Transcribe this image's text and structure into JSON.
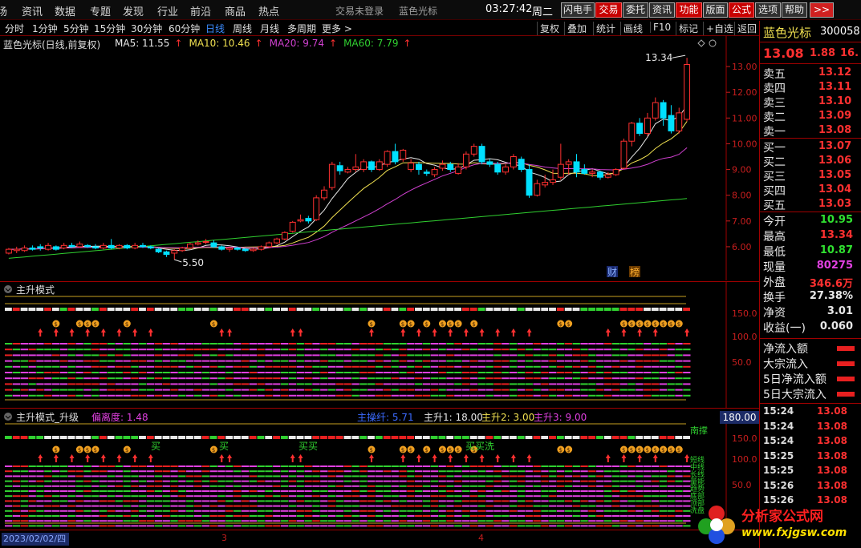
{
  "menu": [
    "场",
    "资讯",
    "数据",
    "专题",
    "发现",
    "行业",
    "前沿",
    "商品",
    "热点"
  ],
  "login_status": "交易未登录",
  "stock_title": "蓝色光标",
  "time": "03:27:42",
  "weekday": "周二",
  "top_buttons": [
    "闪电手",
    "交易",
    "委托",
    "资讯",
    "功能",
    "版面",
    "公式",
    "选项",
    "帮助"
  ],
  "top_button_more": ">>",
  "periods": [
    "分时",
    "1分钟",
    "5分钟",
    "15分钟",
    "30分钟",
    "60分钟",
    "日线",
    "周线",
    "月线",
    "多周期",
    "更多 >"
  ],
  "active_period": "日线",
  "tools": [
    "复权",
    "叠加",
    "统计",
    "画线",
    "F10",
    "标记",
    "+自选",
    "返回"
  ],
  "main_title": "蓝色光标(日线,前复权)",
  "ma": [
    {
      "label": "MA5: 11.55",
      "color": "#e8e8e8"
    },
    {
      "label": "MA10: 10.46",
      "color": "#f0e050"
    },
    {
      "label": "MA20: 9.74",
      "color": "#d040d0"
    },
    {
      "label": "MA60: 7.79",
      "color": "#30d030"
    }
  ],
  "price_axis": [
    "13.00",
    "12.00",
    "11.00",
    "10.00",
    "9.00",
    "8.00",
    "7.00",
    "6.00"
  ],
  "high_annotation": "13.34",
  "low_annotation": "5.50",
  "badges": [
    "财",
    "榜"
  ],
  "pane1": {
    "title": "主升模式",
    "axis": [
      "150.0",
      "100.0",
      "50.0"
    ]
  },
  "pane2": {
    "title": "主升模式_升级",
    "deviation": "偏离度: 1.48",
    "main_text": "主操纤: 5.71",
    "zs1": "主升1: 18.00",
    "zs2": "主升2: 3.00",
    "zs3": "主升3: 9.00",
    "axis": [
      "150.0",
      "100.0",
      "50.0"
    ],
    "axis_highlight": "180.00",
    "buy_labels": [
      "买",
      "买",
      "买买",
      "买买洗"
    ],
    "right_labels": [
      "短线",
      "中线",
      "长线",
      "量能",
      "趋势",
      "底部",
      "顶部",
      "洗盘"
    ],
    "right_top": "南撑"
  },
  "date_axis": {
    "date": "2023/02/02/四",
    "ticks": [
      "3",
      "4"
    ]
  },
  "quote": {
    "name": "蓝色光标",
    "code": "300058",
    "price": "13.08",
    "change": "1.88",
    "pct": "16.",
    "asks": [
      {
        "label": "卖五",
        "price": "13.12"
      },
      {
        "label": "卖四",
        "price": "13.11"
      },
      {
        "label": "卖三",
        "price": "13.10"
      },
      {
        "label": "卖二",
        "price": "13.09"
      },
      {
        "label": "卖一",
        "price": "13.08"
      }
    ],
    "bids": [
      {
        "label": "买一",
        "price": "13.07"
      },
      {
        "label": "买二",
        "price": "13.06"
      },
      {
        "label": "买三",
        "price": "13.05"
      },
      {
        "label": "买四",
        "price": "13.04"
      },
      {
        "label": "买五",
        "price": "13.03"
      }
    ],
    "stats": [
      {
        "label": "今开",
        "value": "10.95",
        "color": "#30e030"
      },
      {
        "label": "最高",
        "value": "13.34",
        "color": "#ff3030"
      },
      {
        "label": "最低",
        "value": "10.87",
        "color": "#30e030"
      },
      {
        "label": "现量",
        "value": "80275",
        "color": "#e040e0"
      },
      {
        "label": "外盘",
        "value": "346.6万",
        "color": "#ff3030"
      },
      {
        "label": "换手",
        "value": "27.38%",
        "color": "#e8e8e8"
      },
      {
        "label": "净资",
        "value": "3.01",
        "color": "#e8e8e8"
      },
      {
        "label": "收益(一)",
        "value": "0.060",
        "color": "#e8e8e8"
      }
    ],
    "flows": [
      "净流入额",
      "大宗流入",
      "5日净流入额",
      "5日大宗流入"
    ],
    "ticks": [
      {
        "time": "15:24",
        "price": "13.08"
      },
      {
        "time": "15:24",
        "price": "13.08"
      },
      {
        "time": "15:24",
        "price": "13.08"
      },
      {
        "time": "15:25",
        "price": "13.08"
      },
      {
        "time": "15:25",
        "price": "13.08"
      },
      {
        "time": "15:26",
        "price": "13.08"
      },
      {
        "time": "15:26",
        "price": "13.08"
      }
    ]
  },
  "watermark": {
    "text": "分析家公式网",
    "url": "www.fxjgsw.com"
  },
  "chart_data": {
    "type": "candlestick",
    "ylim": [
      5.5,
      13.5
    ],
    "candles": [
      [
        5.75,
        5.9,
        5.95,
        5.7
      ],
      [
        5.85,
        5.9,
        6.0,
        5.75
      ],
      [
        5.85,
        5.95,
        6.05,
        5.8
      ],
      [
        5.95,
        5.9,
        6.05,
        5.85
      ],
      [
        6.0,
        5.95,
        6.1,
        5.85
      ],
      [
        5.9,
        6.05,
        6.15,
        5.85
      ],
      [
        6.0,
        5.9,
        6.05,
        5.85
      ],
      [
        5.95,
        6.05,
        6.15,
        5.9
      ],
      [
        6.05,
        6.0,
        6.15,
        5.95
      ],
      [
        6.0,
        6.1,
        6.2,
        5.95
      ],
      [
        6.05,
        6.0,
        6.1,
        5.95
      ],
      [
        6.0,
        5.95,
        6.1,
        5.9
      ],
      [
        5.95,
        6.05,
        6.15,
        5.9
      ],
      [
        6.05,
        5.95,
        6.3,
        5.9
      ],
      [
        5.95,
        6.05,
        6.1,
        5.9
      ],
      [
        6.05,
        5.95,
        6.1,
        5.9
      ],
      [
        5.95,
        6.05,
        6.15,
        5.9
      ],
      [
        6.05,
        6.0,
        6.15,
        5.95
      ],
      [
        6.0,
        5.95,
        6.05,
        5.9
      ],
      [
        5.9,
        5.8,
        5.95,
        5.75
      ],
      [
        5.8,
        5.7,
        5.85,
        5.6
      ],
      [
        5.75,
        5.85,
        5.9,
        5.5
      ],
      [
        5.85,
        5.95,
        6.0,
        5.8
      ],
      [
        5.95,
        6.1,
        6.15,
        5.9
      ],
      [
        6.1,
        6.15,
        6.25,
        6.05
      ],
      [
        6.2,
        6.2,
        6.3,
        6.1
      ],
      [
        6.15,
        6.0,
        6.25,
        5.95
      ],
      [
        6.0,
        5.9,
        6.05,
        5.85
      ],
      [
        5.9,
        5.95,
        6.0,
        5.8
      ],
      [
        5.95,
        5.9,
        6.0,
        5.85
      ],
      [
        5.9,
        5.85,
        5.95,
        5.8
      ],
      [
        5.85,
        5.9,
        5.95,
        5.8
      ],
      [
        5.9,
        6.0,
        6.05,
        5.85
      ],
      [
        6.0,
        6.15,
        6.2,
        5.95
      ],
      [
        6.15,
        6.3,
        6.35,
        6.1
      ],
      [
        6.3,
        6.55,
        6.6,
        6.25
      ],
      [
        6.6,
        6.95,
        7.0,
        6.55
      ],
      [
        7.0,
        7.05,
        7.25,
        6.95
      ],
      [
        7.1,
        7.0,
        7.2,
        6.9
      ],
      [
        7.05,
        7.9,
        8.0,
        7.0
      ],
      [
        7.9,
        8.2,
        8.35,
        7.8
      ],
      [
        8.3,
        9.2,
        9.3,
        8.2
      ],
      [
        9.15,
        8.95,
        9.3,
        8.8
      ],
      [
        8.9,
        9.0,
        9.1,
        8.85
      ],
      [
        9.0,
        9.1,
        9.6,
        8.9
      ],
      [
        9.0,
        9.3,
        9.4,
        8.9
      ],
      [
        9.3,
        9.0,
        9.35,
        8.9
      ],
      [
        9.0,
        9.3,
        9.4,
        8.95
      ],
      [
        9.2,
        9.7,
        9.75,
        9.1
      ],
      [
        9.7,
        9.3,
        10.0,
        9.2
      ],
      [
        9.4,
        9.75,
        9.8,
        9.3
      ],
      [
        9.0,
        9.25,
        9.4,
        8.9
      ],
      [
        9.2,
        9.0,
        9.3,
        8.8
      ],
      [
        8.9,
        8.85,
        9.0,
        8.75
      ],
      [
        8.8,
        9.0,
        9.1,
        8.7
      ],
      [
        9.05,
        9.2,
        9.35,
        8.95
      ],
      [
        9.2,
        9.0,
        9.3,
        8.9
      ],
      [
        8.85,
        9.1,
        9.25,
        8.8
      ],
      [
        9.1,
        9.6,
        9.7,
        9.0
      ],
      [
        9.6,
        9.9,
        10.0,
        9.5
      ],
      [
        9.9,
        9.3,
        10.0,
        9.2
      ],
      [
        9.3,
        9.2,
        9.4,
        9.1
      ],
      [
        9.2,
        8.9,
        9.3,
        8.8
      ],
      [
        8.9,
        9.1,
        9.2,
        8.8
      ],
      [
        9.1,
        9.5,
        9.6,
        9.0
      ],
      [
        9.4,
        9.0,
        9.5,
        8.9
      ],
      [
        9.0,
        8.0,
        9.2,
        7.9
      ],
      [
        8.0,
        8.45,
        8.6,
        7.95
      ],
      [
        8.4,
        8.5,
        8.8,
        8.3
      ],
      [
        8.5,
        8.6,
        9.0,
        8.4
      ],
      [
        8.7,
        9.2,
        10.0,
        8.6
      ],
      [
        9.2,
        9.3,
        9.4,
        8.8
      ],
      [
        9.3,
        8.9,
        9.6,
        8.7
      ],
      [
        9.0,
        8.85,
        9.2,
        8.8
      ],
      [
        8.85,
        8.9,
        9.0,
        8.7
      ],
      [
        8.9,
        8.7,
        8.95,
        8.6
      ],
      [
        8.7,
        8.8,
        8.9,
        8.65
      ],
      [
        8.8,
        9.0,
        9.05,
        8.75
      ],
      [
        9.05,
        10.1,
        10.2,
        9.0
      ],
      [
        10.1,
        10.8,
        10.85,
        9.9
      ],
      [
        10.8,
        10.4,
        11.0,
        10.3
      ],
      [
        10.4,
        11.0,
        11.2,
        10.3
      ],
      [
        11.0,
        11.6,
        11.8,
        10.9
      ],
      [
        11.6,
        11.0,
        11.7,
        10.7
      ],
      [
        11.1,
        10.5,
        11.5,
        10.4
      ],
      [
        10.5,
        11.2,
        11.4,
        10.4
      ],
      [
        10.95,
        13.08,
        13.34,
        10.87
      ]
    ]
  }
}
